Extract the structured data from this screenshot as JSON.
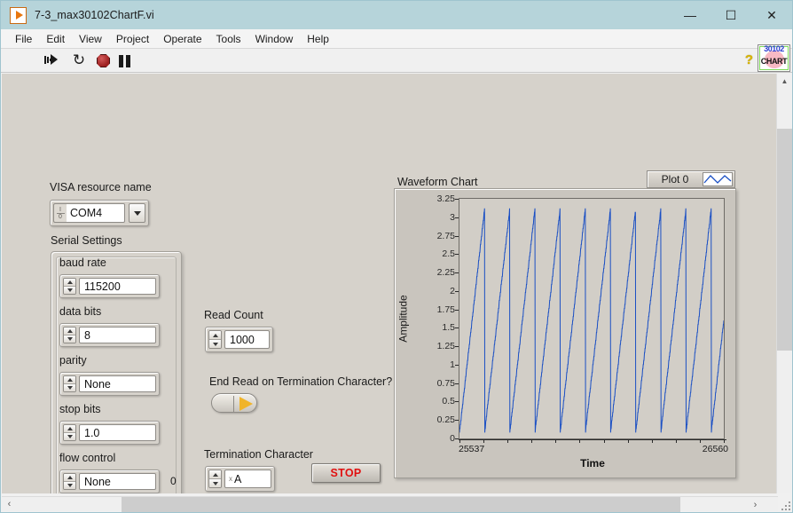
{
  "window": {
    "title": "7-3_max30102ChartF.vi",
    "minimize_label": "—",
    "maximize_label": "☐",
    "close_label": "✕"
  },
  "menu": {
    "items": [
      {
        "label": "File"
      },
      {
        "label": "Edit"
      },
      {
        "label": "View"
      },
      {
        "label": "Project"
      },
      {
        "label": "Operate"
      },
      {
        "label": "Tools"
      },
      {
        "label": "Window"
      },
      {
        "label": "Help"
      }
    ]
  },
  "toolbar": {
    "run_name": "run-arrow-icon",
    "run_continuous_name": "run-continuously-icon",
    "abort_name": "abort-execution-icon",
    "pause_name": "pause-icon",
    "loop_glyph": "↻",
    "help_glyph": "?",
    "vi_icon": {
      "line1": "30102",
      "line2": "CHART"
    }
  },
  "panel": {
    "visa": {
      "label": "VISA resource name",
      "value": "COM4",
      "io_top": "I",
      "io_bottom": "0"
    },
    "serial_settings": {
      "label": "Serial Settings",
      "controls": [
        {
          "label": "baud rate",
          "value": "115200"
        },
        {
          "label": "data bits",
          "value": "8"
        },
        {
          "label": "parity",
          "value": "None"
        },
        {
          "label": "stop bits",
          "value": "1.0"
        },
        {
          "label": "flow control",
          "value": "None"
        }
      ],
      "flow_control_indicator": "0"
    },
    "read_count": {
      "label": "Read Count",
      "value": "1000"
    },
    "end_read_switch": {
      "label": "End Read on Termination Character?",
      "state": "off"
    },
    "termination_character": {
      "label": "Termination Character",
      "radix": "x",
      "value": "A"
    },
    "stop_button": {
      "label": "STOP",
      "color": "#e01010"
    }
  },
  "chart_data": {
    "type": "line",
    "title": "Waveform Chart",
    "xlabel": "Time",
    "ylabel": "Amplitude",
    "legend": {
      "position": "top-right",
      "entries": [
        {
          "name": "Plot 0",
          "color": "#1a4fc4"
        }
      ]
    },
    "grid": false,
    "ylim": [
      0,
      3.25
    ],
    "xlim": [
      25537,
      26560
    ],
    "yticks": [
      "0",
      "0.25",
      "0.5",
      "0.75",
      "1",
      "1.25",
      "1.5",
      "1.75",
      "2",
      "2.25",
      "2.5",
      "2.75",
      "3",
      "3.25"
    ],
    "ytick_values": [
      0,
      0.25,
      0.5,
      0.75,
      1,
      1.25,
      1.5,
      1.75,
      2,
      2.25,
      2.5,
      2.75,
      3,
      3.25
    ],
    "xticks": [
      "25537",
      "26560"
    ],
    "xtick_values": [
      25537,
      26560
    ],
    "series": [
      {
        "name": "Plot 0",
        "color": "#1a4fc4",
        "waveform": "sawtooth",
        "cycles": 10.5,
        "ramp_min": 0.08,
        "ramp_max": 3.12,
        "description": "Rising sawtooth ramps from ~0.08 to ~3.12 with sharp vertical fall-back; about 10.5 cycles visible across the 25537-26560 time window."
      }
    ]
  },
  "scrollbars": {
    "v_up": "▲",
    "v_down": "▼",
    "h_left": "‹",
    "h_right": "›"
  }
}
